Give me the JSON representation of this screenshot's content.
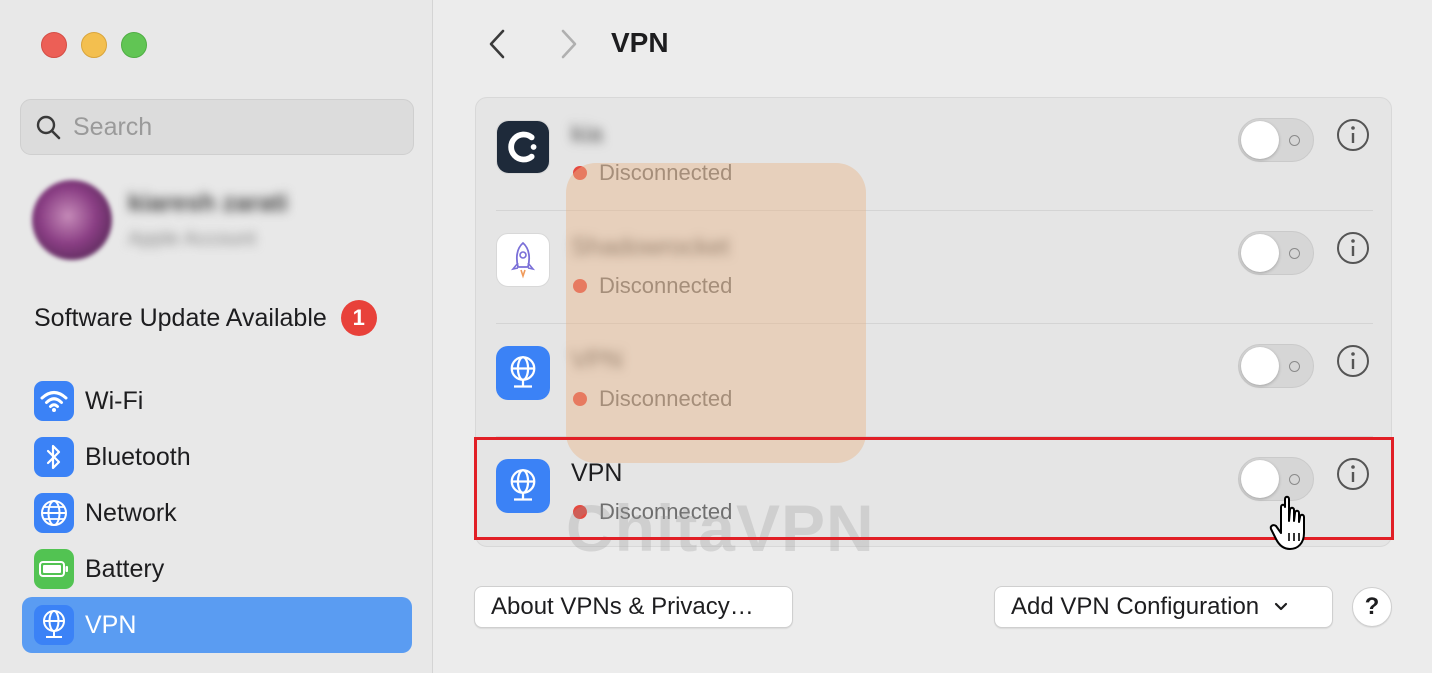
{
  "window": {
    "title": "VPN"
  },
  "sidebar": {
    "search": {
      "placeholder": "Search",
      "icon": "magnifying-glass-icon"
    },
    "account": {
      "name": "kiaresh zarati",
      "subtitle": "Apple Account"
    },
    "software_update": {
      "label": "Software Update Available",
      "badge": "1"
    },
    "items": [
      {
        "label": "Wi-Fi",
        "icon": "wifi-icon",
        "color": "#3b82f6"
      },
      {
        "label": "Bluetooth",
        "icon": "bluetooth-icon",
        "color": "#3b82f6"
      },
      {
        "label": "Network",
        "icon": "globe-icon",
        "color": "#3b82f6"
      },
      {
        "label": "Battery",
        "icon": "battery-icon",
        "color": "#52c352"
      },
      {
        "label": "VPN",
        "icon": "vpn-globe-icon",
        "color": "#3b82f6",
        "selected": true
      }
    ]
  },
  "main": {
    "title": "VPN",
    "vpn_list": [
      {
        "name": "kia",
        "name_blurred": true,
        "status": "Disconnected",
        "icon": "cisco-anyconnect-icon",
        "enabled": false
      },
      {
        "name": "Shadowrocket",
        "name_blurred": true,
        "status": "Disconnected",
        "icon": "rocket-icon",
        "enabled": false
      },
      {
        "name": "VPN",
        "name_blurred": true,
        "status": "Disconnected",
        "icon": "vpn-globe-icon",
        "enabled": false
      },
      {
        "name": "VPN",
        "name_blurred": false,
        "status": "Disconnected",
        "icon": "vpn-globe-icon",
        "enabled": false,
        "highlighted": true
      }
    ],
    "buttons": {
      "about": "About VPNs & Privacy…",
      "add": "Add VPN Configuration",
      "help": "?"
    }
  },
  "watermark": {
    "text": "ChitaVPN"
  },
  "colors": {
    "accent": "#5a9cf2",
    "status_dot": "#e5493f",
    "highlight_border": "#e11f26",
    "badge": "#e8413a"
  }
}
